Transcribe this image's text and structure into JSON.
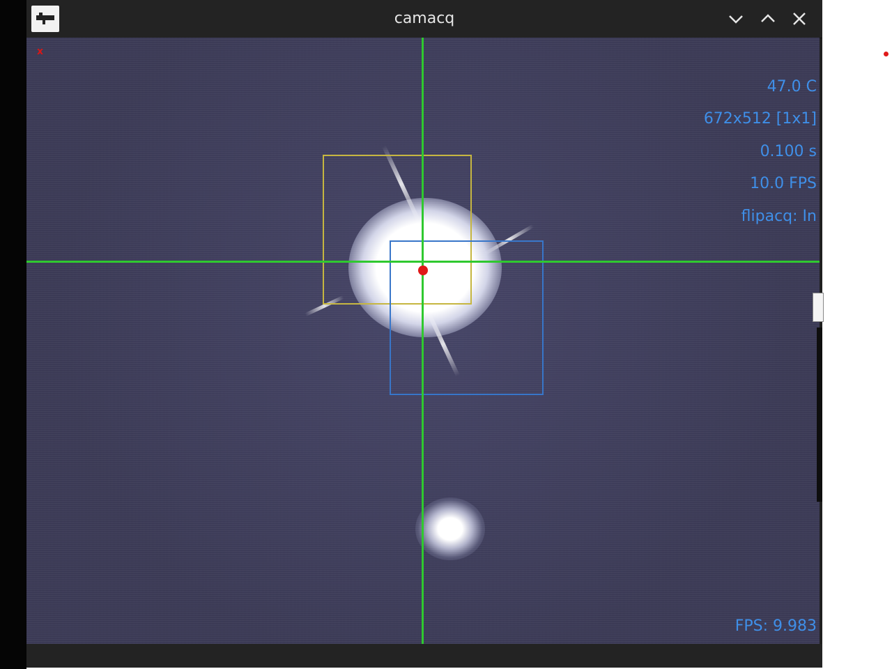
{
  "window": {
    "title": "camacq",
    "icon": "app-logo-icon",
    "buttons": [
      {
        "name": "minimize-button",
        "icon": "chevron-down-icon"
      },
      {
        "name": "maximize-button",
        "icon": "chevron-up-icon"
      },
      {
        "name": "close-button",
        "icon": "close-icon"
      }
    ]
  },
  "camera_overlay": {
    "temperature": "47.0  C",
    "resolution": "672x512  [1x1]",
    "exposure": "0.100  s",
    "frame_rate": "10.0  FPS",
    "flipacq": "flipacq:  In",
    "measured_fps": "FPS:  9.983",
    "corner_marker": "x"
  },
  "colors": {
    "overlay_text": "#3f8fe8",
    "crosshair": "#2fc92f",
    "roi_primary": "#c6b640",
    "roi_secondary": "#3876c9",
    "centroid": "#e01818",
    "sky_background": "#3e3d5a"
  }
}
